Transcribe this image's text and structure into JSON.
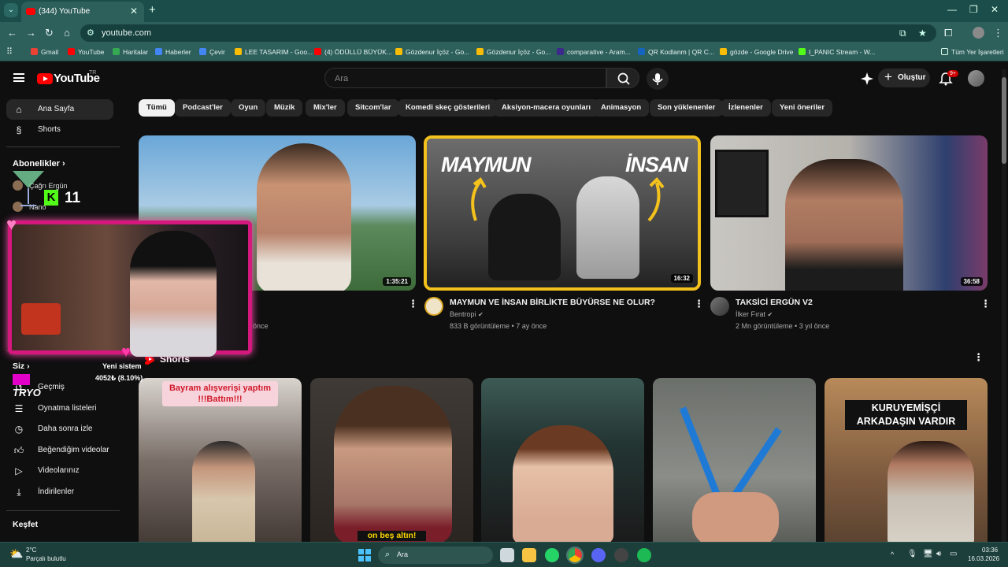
{
  "browser": {
    "tab_title": "(344) YouTube",
    "url": "youtube.com",
    "bookmarks": [
      "Gmail",
      "YouTube",
      "Haritalar",
      "Haberler",
      "Çevir",
      "LEE TASARIM - Goo...",
      "(4) ÖDÜLLÜ BÜYÜK...",
      "Gözdenur İçöz - Go...",
      "Gözdenur İçöz - Go...",
      "comparative - Aram...",
      "QR Kodlanm | QR C...",
      "gözde - Google Drive",
      "I_PANIC Stream - W..."
    ],
    "all_bookmarks": "Tüm Yer İşaretleri"
  },
  "masthead": {
    "logo": "YouTube",
    "logo_cc": "TR",
    "search_placeholder": "Ara",
    "create_label": "Oluştur",
    "notif_badge": "9+"
  },
  "sidebar": {
    "home": "Ana Sayfa",
    "shorts": "Shorts",
    "subs_head": "Abonelikler",
    "subs": [
      "Çağrı Ergün",
      "Nano"
    ],
    "you_head": "Siz",
    "you_items": [
      "Geçmiş",
      "Oynatma listeleri",
      "Daha sonra izle",
      "Beğendiğim videolar",
      "Videolarınız",
      "İndirilenler"
    ],
    "explore_head": "Keşfet"
  },
  "chips": [
    "Tümü",
    "Podcast'ler",
    "Oyun",
    "Müzik",
    "Mix'ler",
    "Sitcom'lar",
    "Komedi skeç gösterileri",
    "Aksiyon-macera oyunları",
    "Animasyon",
    "Son yüklenenler",
    "İzlenenler",
    "Yeni öneriler"
  ],
  "videos": [
    {
      "title": "",
      "channel": "",
      "meta": "önce",
      "duration": "1:35:21"
    },
    {
      "title": "MAYMUN VE İNSAN BİRLİKTE BÜYÜRSE NE OLUR?",
      "channel": "Bentropi",
      "meta": "833 B görüntüleme • 7 ay önce",
      "duration": "16:32",
      "thumb_left": "MAYMUN",
      "thumb_right": "İNSAN"
    },
    {
      "title": "TAKSİCİ ERGÜN V2",
      "channel": "İlker Fırat",
      "meta": "2 Mn görüntüleme • 3 yıl önce",
      "duration": "36:58"
    }
  ],
  "shorts_section": {
    "title": "Shorts",
    "captions": [
      "Bayram alışverişi yaptım !!!Battım!!!",
      "on beş altın!",
      "",
      "",
      "KURUYEMİŞÇİ ARKADAŞIN VARDIR"
    ]
  },
  "overlay": {
    "counter": "11",
    "new_system": "Yeni sistem",
    "progress": "4052₺ (8.10%)",
    "tag": "TRYO"
  },
  "taskbar": {
    "temp": "2°C",
    "weather": "Parçalı bulutlu",
    "search": "Ara",
    "time": "03:36",
    "date": "16.03.2026"
  }
}
